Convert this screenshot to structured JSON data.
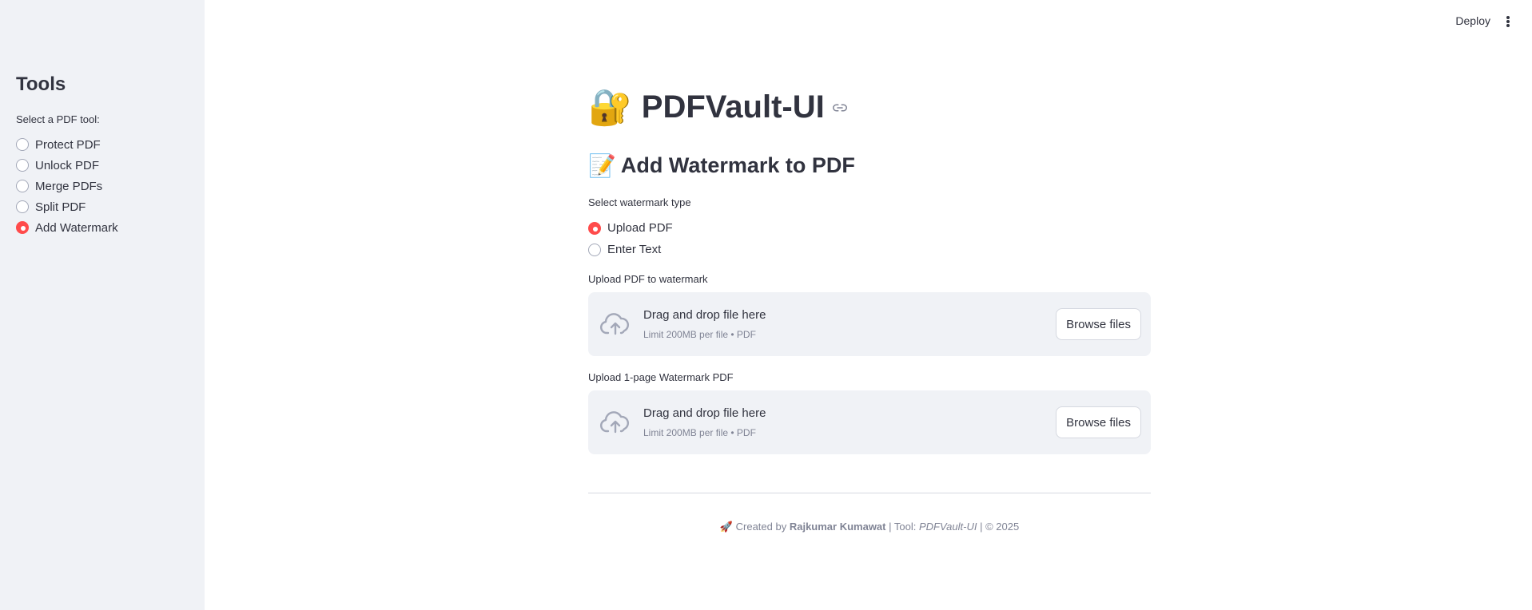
{
  "header": {
    "deploy_label": "Deploy"
  },
  "sidebar": {
    "title": "Tools",
    "select_label": "Select a PDF tool:",
    "items": [
      {
        "label": "Protect PDF",
        "selected": false
      },
      {
        "label": "Unlock PDF",
        "selected": false
      },
      {
        "label": "Merge PDFs",
        "selected": false
      },
      {
        "label": "Split PDF",
        "selected": false
      },
      {
        "label": "Add Watermark",
        "selected": true
      }
    ]
  },
  "main": {
    "app_emoji": "🔐",
    "app_title": "PDFVault-UI",
    "section_emoji": "📝",
    "section_title": "Add Watermark to PDF",
    "watermark_type_label": "Select watermark type",
    "watermark_types": [
      {
        "label": "Upload PDF",
        "selected": true
      },
      {
        "label": "Enter Text",
        "selected": false
      }
    ],
    "uploaders": [
      {
        "label": "Upload PDF to watermark",
        "drop_text": "Drag and drop file here",
        "limit_text": "Limit 200MB per file • PDF",
        "button_label": "Browse files"
      },
      {
        "label": "Upload 1-page Watermark PDF",
        "drop_text": "Drag and drop file here",
        "limit_text": "Limit 200MB per file • PDF",
        "button_label": "Browse files"
      }
    ]
  },
  "footer": {
    "emoji": "🚀",
    "created_by": "Created by",
    "author": "Rajkumar Kumawat",
    "sep1": "| Tool:",
    "tool": "PDFVault-UI",
    "sep2": "| © 2025"
  },
  "colors": {
    "accent": "#ff4b4b",
    "sidebar_bg": "#f0f2f6",
    "text": "#31333f",
    "muted": "#808495"
  }
}
